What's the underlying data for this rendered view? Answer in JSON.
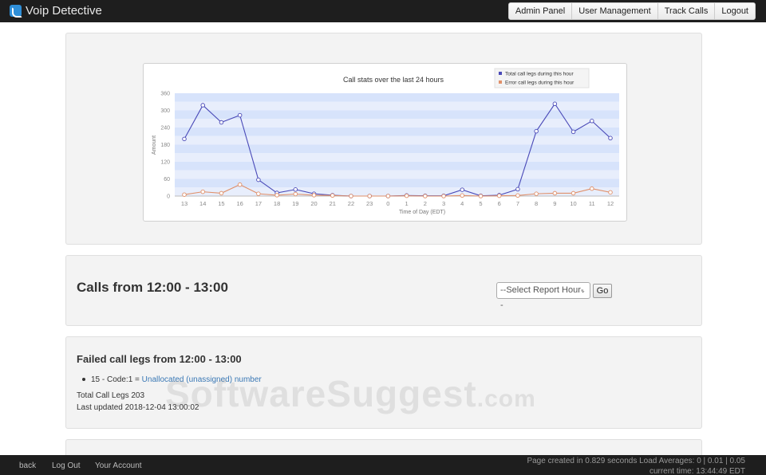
{
  "app": {
    "title": "Voip Detective"
  },
  "nav": {
    "items": [
      "Admin Panel",
      "User Management",
      "Track Calls",
      "Logout"
    ]
  },
  "chart_data": {
    "type": "line",
    "title": "Call stats over the last 24 hours",
    "xlabel": "Time of Day (EDT)",
    "ylabel": "Amount",
    "ylim": [
      0,
      360
    ],
    "yticks": [
      0,
      60,
      120,
      180,
      240,
      300,
      360
    ],
    "categories": [
      "13",
      "14",
      "15",
      "16",
      "17",
      "18",
      "19",
      "20",
      "21",
      "22",
      "23",
      "0",
      "1",
      "2",
      "3",
      "4",
      "5",
      "6",
      "7",
      "8",
      "9",
      "10",
      "11",
      "12"
    ],
    "legend_position": "top-right",
    "grid": true,
    "series": [
      {
        "name": "Total call legs during this hour",
        "color": "#4a4ab8",
        "values": [
          200,
          318,
          258,
          283,
          57,
          11,
          23,
          8,
          3,
          0,
          0,
          0,
          2,
          1,
          1,
          22,
          1,
          3,
          24,
          227,
          323,
          225,
          263,
          203
        ]
      },
      {
        "name": "Error call legs during this hour",
        "color": "#e0906a",
        "values": [
          5,
          15,
          10,
          40,
          8,
          3,
          7,
          3,
          2,
          0,
          0,
          0,
          1,
          0,
          0,
          2,
          0,
          1,
          2,
          8,
          10,
          10,
          26,
          13
        ]
      }
    ]
  },
  "colors": {
    "band_dark": "#d7e3fb",
    "band_light": "#e8eefc"
  },
  "calls": {
    "title": "Calls from 12:00 - 13:00",
    "select_value": "--Select Report Hour--",
    "go_label": "Go"
  },
  "failed": {
    "title": "Failed call legs from 12:00 - 13:00",
    "item_prefix": "15 - Code:1 = ",
    "item_link": "Unallocated (unassigned) number",
    "total": "Total Call Legs 203",
    "updated": "Last updated 2018-12-04 13:00:02"
  },
  "watermark": {
    "main": "SoftwareSuggest",
    "suffix": ".com"
  },
  "footer": {
    "links": [
      "back",
      "Log Out",
      "Your Account"
    ],
    "stats": "Page created in 0.829 seconds Load Averages: 0 | 0.01 | 0.05",
    "time": "current time: 13:44:49 EDT"
  }
}
